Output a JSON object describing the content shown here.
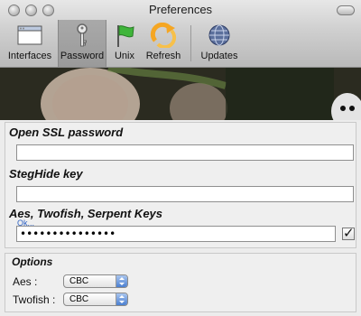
{
  "window": {
    "title": "Preferences"
  },
  "toolbar": {
    "items": [
      {
        "label": "Interfaces",
        "icon": "window-icon"
      },
      {
        "label": "Password",
        "icon": "key-icon",
        "selected": true
      },
      {
        "label": "Unix",
        "icon": "flag-icon"
      },
      {
        "label": "Refresh",
        "icon": "refresh-icon"
      },
      {
        "label": "Updates",
        "icon": "globe-icon"
      }
    ]
  },
  "password": {
    "openssl_label": "Open SSL password",
    "openssl_value": "",
    "steghide_label": "StegHide key",
    "steghide_value": "",
    "keys_label": "Aes, Twofish, Serpent Keys",
    "keys_link": "Ok...",
    "keys_value": "•••••••••••••••",
    "keys_checked": true
  },
  "options": {
    "label": "Options",
    "rows": [
      {
        "label": "Aes :",
        "value": "CBC"
      },
      {
        "label": "Twofish :",
        "value": "CBC"
      }
    ]
  },
  "colors": {
    "link": "#2f62c4",
    "popup_arrow": "#4a7fd0"
  }
}
